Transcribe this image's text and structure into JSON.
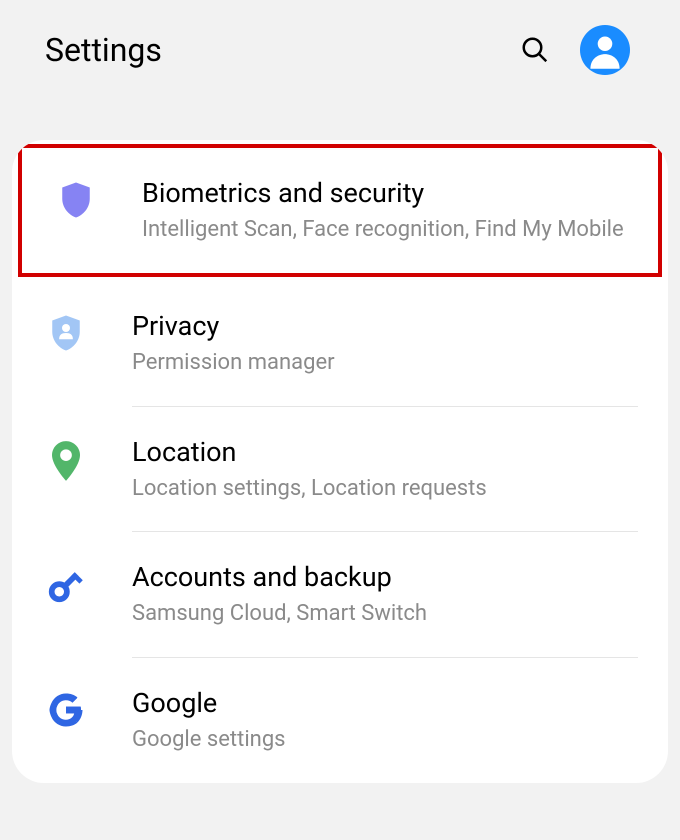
{
  "header": {
    "title": "Settings"
  },
  "items": [
    {
      "title": "Biometrics and security",
      "subtitle": "Intelligent Scan, Face recognition, Find My Mobile"
    },
    {
      "title": "Privacy",
      "subtitle": "Permission manager"
    },
    {
      "title": "Location",
      "subtitle": "Location settings, Location requests"
    },
    {
      "title": "Accounts and backup",
      "subtitle": "Samsung Cloud, Smart Switch"
    },
    {
      "title": "Google",
      "subtitle": "Google settings"
    }
  ]
}
